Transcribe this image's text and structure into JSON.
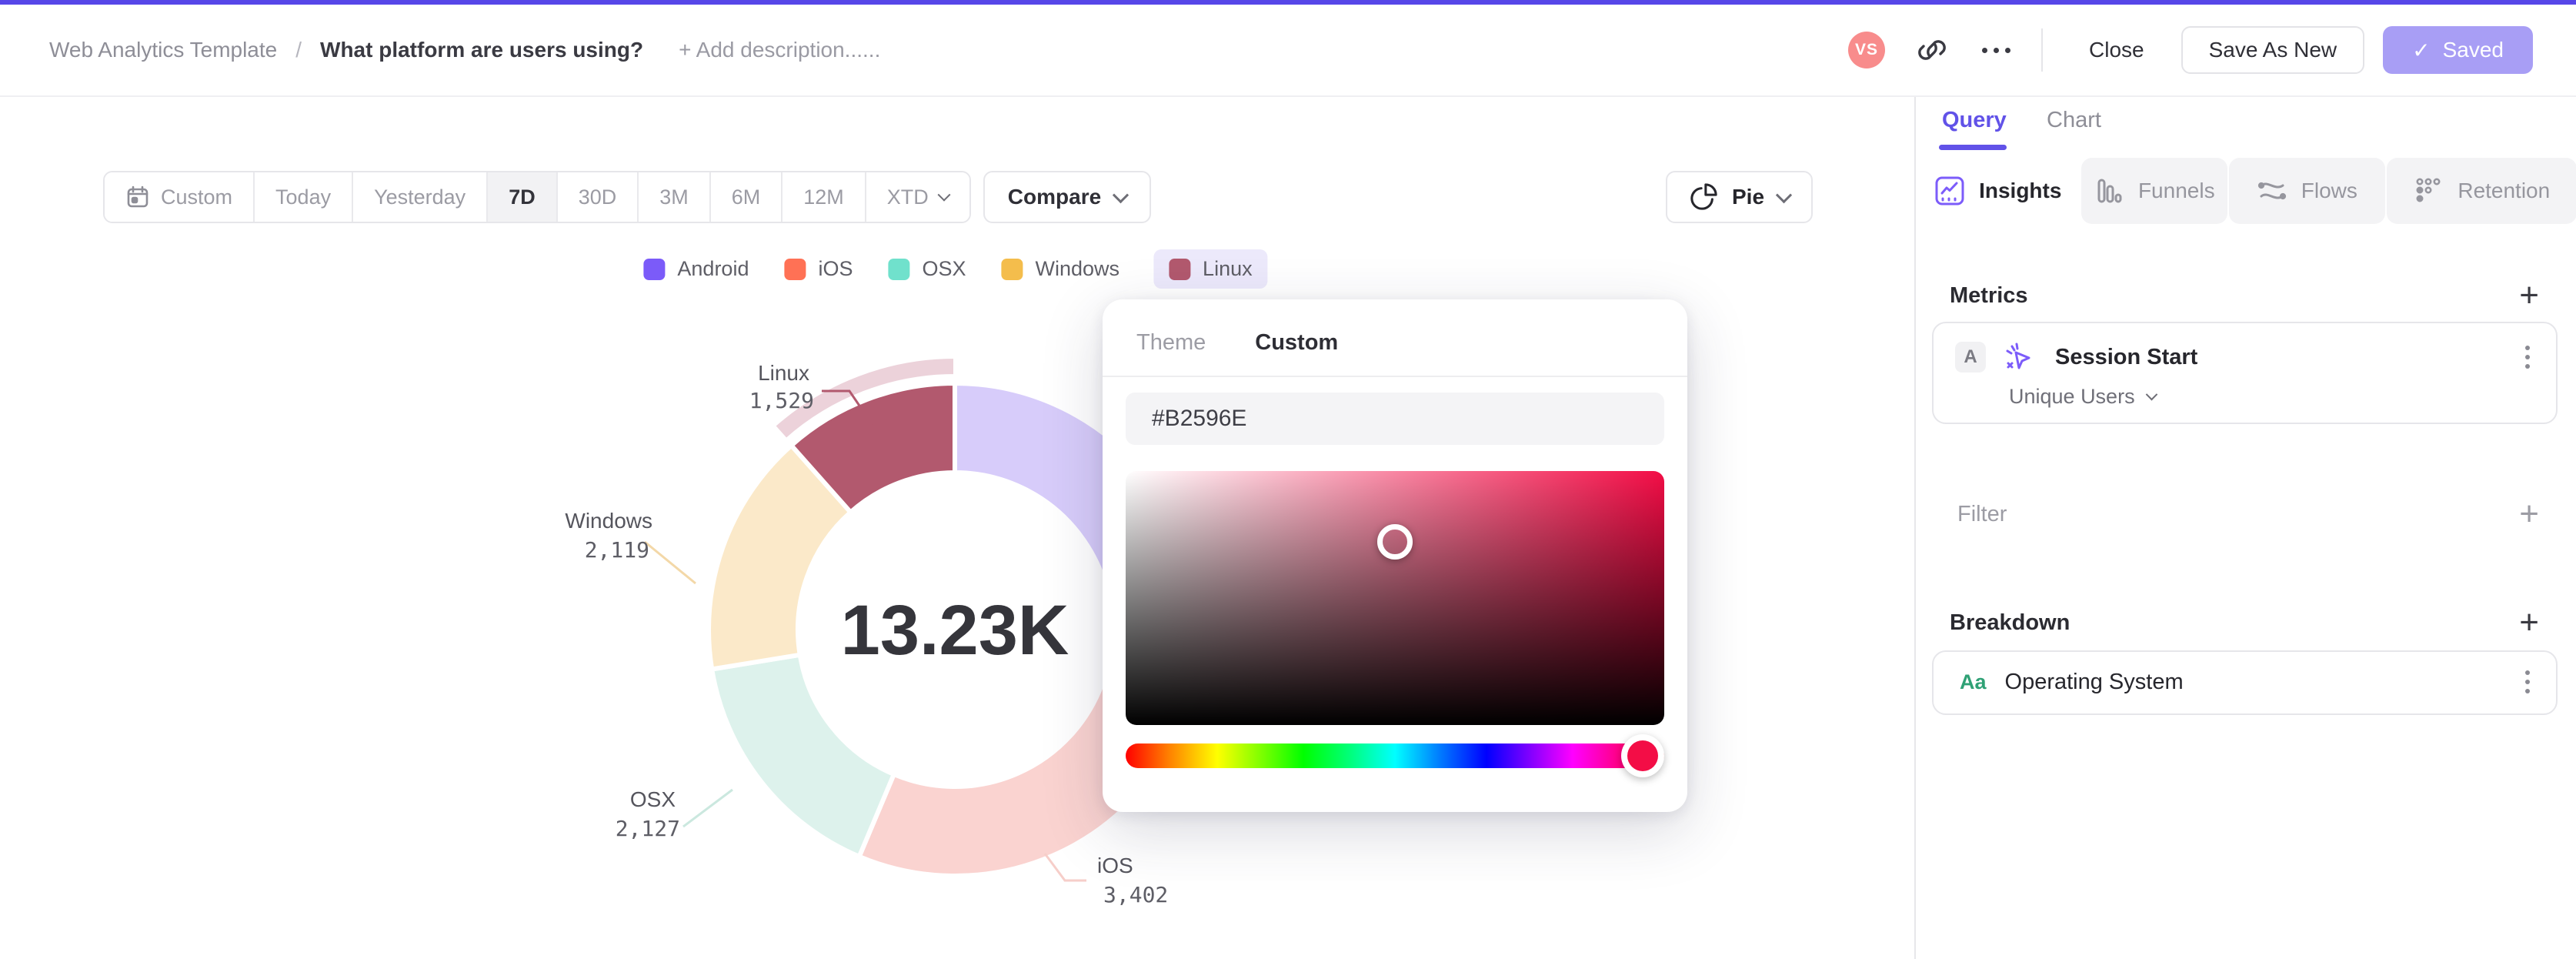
{
  "header": {
    "breadcrumb": "Web Analytics Template",
    "separator": "/",
    "title": "What platform are users using?",
    "add_description": "+ Add description......",
    "avatar_initials": "VS",
    "close_label": "Close",
    "save_as_new_label": "Save As New",
    "saved_label": "Saved",
    "saved_check": "✓"
  },
  "toolbar": {
    "ranges": [
      "Custom",
      "Today",
      "Yesterday",
      "7D",
      "30D",
      "3M",
      "6M",
      "12M",
      "XTD"
    ],
    "active_range": "7D",
    "compare_label": "Compare",
    "chart_type_label": "Pie"
  },
  "legend": {
    "items": [
      {
        "label": "Android",
        "color": "#7B5BF9",
        "selected": false
      },
      {
        "label": "iOS",
        "color": "#FF7155",
        "selected": false
      },
      {
        "label": "OSX",
        "color": "#70E1CC",
        "selected": false
      },
      {
        "label": "Windows",
        "color": "#F4BD4C",
        "selected": false
      },
      {
        "label": "Linux",
        "color": "#B2596E",
        "selected": true
      }
    ]
  },
  "chart_data": {
    "type": "pie",
    "subtype": "donut",
    "title": "",
    "total_label": "13.23K",
    "categories": [
      "Android",
      "iOS",
      "OSX",
      "Windows",
      "Linux"
    ],
    "values": [
      4053,
      3402,
      2127,
      2119,
      1529
    ],
    "value_labels": [
      "",
      "3,402",
      "2,127",
      "2,119",
      "1,529"
    ],
    "selected_slice": "Linux",
    "colors": [
      "#7B5BF9",
      "#FF7155",
      "#70E1CC",
      "#F4BD4C",
      "#B2596E"
    ],
    "muted_colors": [
      "#D7CCFA",
      "#FAD3D0",
      "#DDF2EC",
      "#FBE9C9",
      "#B2596E"
    ],
    "halo_color": "#ECD2DA",
    "legend_position": "top"
  },
  "color_picker": {
    "theme_tab": "Theme",
    "custom_tab": "Custom",
    "active_tab": "Custom",
    "hex_value": "#B2596E",
    "hue_color": "#F30D46",
    "pointer_x_pct": 50,
    "pointer_y_pct": 28,
    "hue_position_pct": 96
  },
  "sidebar": {
    "tabs": [
      {
        "label": "Query",
        "active": true
      },
      {
        "label": "Chart",
        "active": false
      }
    ],
    "insight_tabs": [
      {
        "label": "Insights",
        "icon": "insights-icon",
        "active": true
      },
      {
        "label": "Funnels",
        "icon": "funnels-icon",
        "active": false
      },
      {
        "label": "Flows",
        "icon": "flows-icon",
        "active": false
      },
      {
        "label": "Retention",
        "icon": "retention-icon",
        "active": false
      }
    ],
    "metrics": {
      "heading": "Metrics",
      "add_label": "+",
      "card": {
        "series_badge": "A",
        "icon": "session-start-icon",
        "event_name": "Session Start",
        "aggregation": "Unique Users"
      }
    },
    "filter": {
      "heading": "Filter",
      "add_label": "+"
    },
    "breakdown": {
      "heading": "Breakdown",
      "add_label": "+",
      "card": {
        "type_badge": "Aa",
        "property": "Operating System"
      }
    }
  }
}
